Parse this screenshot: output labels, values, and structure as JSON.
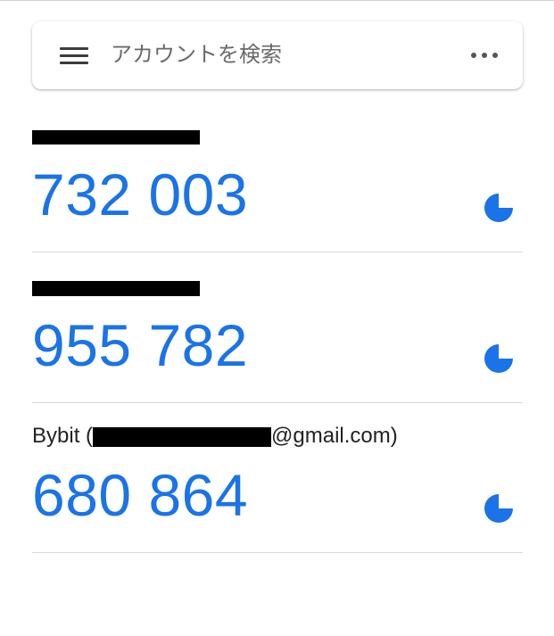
{
  "search": {
    "placeholder": "アカウントを検索",
    "menu_icon": "hamburger-menu-icon",
    "more_icon": "more-horizontal-icon"
  },
  "accounts": [
    {
      "name": "",
      "code": "732 003",
      "timer_icon": "countdown-timer-icon"
    },
    {
      "name": "",
      "code": "955 782",
      "timer_icon": "countdown-timer-icon"
    },
    {
      "name_prefix": "Bybit (",
      "name_suffix": "@gmail.com)",
      "code": "680 864",
      "timer_icon": "countdown-timer-icon"
    }
  ],
  "colors": {
    "code": "#1a73e8",
    "timer": "#1a73e8",
    "redaction": "#000000"
  }
}
